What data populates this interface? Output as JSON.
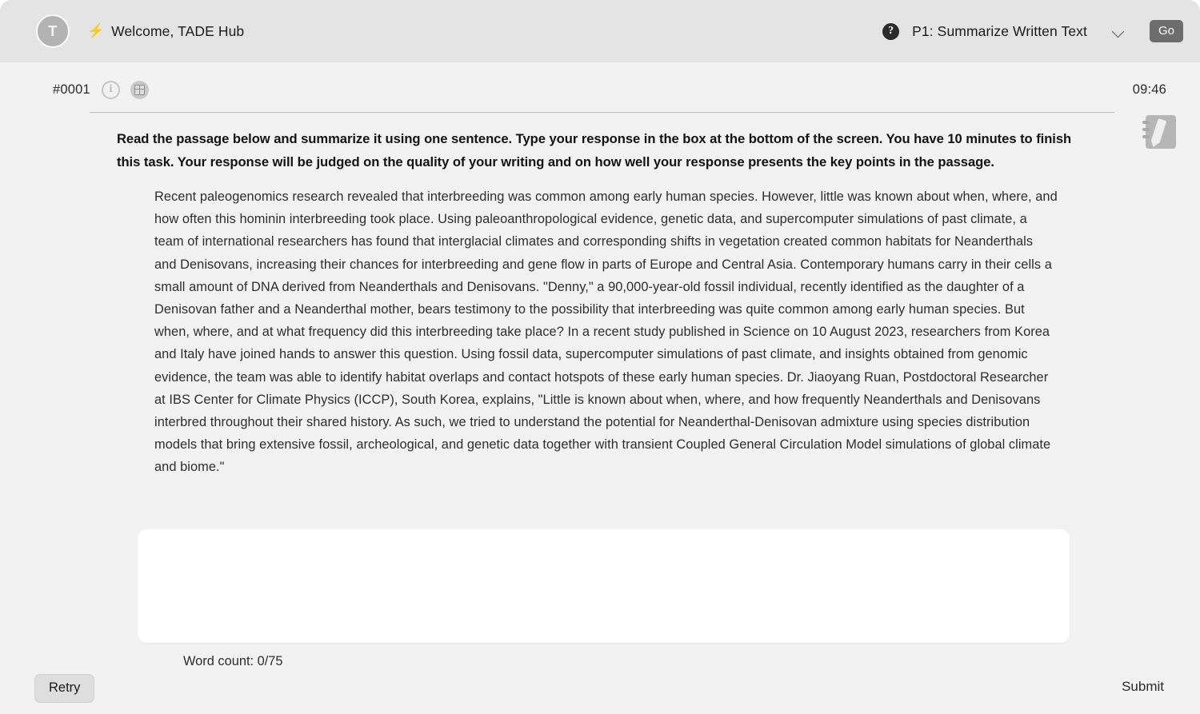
{
  "header": {
    "avatar_initial": "T",
    "bolt_icon": "⚡",
    "welcome_text": "Welcome, TADE Hub",
    "help_icon": "?",
    "task_label": "P1: Summarize Written Text",
    "go_label": "Go"
  },
  "item_bar": {
    "item_id": "#0001",
    "info_icon": "i",
    "timer": "09:46"
  },
  "task": {
    "instructions": "Read the passage below and summarize it using one sentence. Type your response in the box at the bottom of the screen. You have 10 minutes to finish this task. Your response will be judged on the quality of your writing and on how well your response presents the key points in the passage.",
    "passage": "Recent paleogenomics research revealed that interbreeding was common among early human species. However, little was known about when, where, and how often this hominin interbreeding took place. Using paleoanthropological evidence, genetic data, and supercomputer simulations of past climate, a team of international researchers has found that interglacial climates and corresponding shifts in vegetation created common habitats for Neanderthals and Denisovans, increasing their chances for interbreeding and gene flow in parts of Europe and Central Asia. Contemporary humans carry in their cells a small amount of DNA derived from Neanderthals and Denisovans. \"Denny,\" a 90,000-year-old fossil individual, recently identified as the daughter of a Denisovan father and a Neanderthal mother, bears testimony to the possibility that interbreeding was quite common among early human species. But when, where, and at what frequency did this interbreeding take place? In a recent study published in Science on 10 August 2023, researchers from Korea and Italy have joined hands to answer this question. Using fossil data, supercomputer simulations of past climate, and insights obtained from genomic evidence, the team was able to identify habitat overlaps and contact hotspots of these early human species. Dr. Jiaoyang Ruan, Postdoctoral Researcher at IBS Center for Climate Physics (ICCP), South Korea, explains, \"Little is known about when, where, and how frequently Neanderthals and Denisovans interbred throughout their shared history. As such, we tried to understand the potential for Neanderthal-Denisovan admixture using species distribution models that bring extensive fossil, archeological, and genetic data together with transient Coupled General Circulation Model simulations of global climate and biome.\""
  },
  "answer": {
    "value": "",
    "placeholder": "",
    "word_count": "Word count: 0/75"
  },
  "footer": {
    "retry_label": "Retry",
    "submit_label": "Submit"
  },
  "colors": {
    "page_background": "#f2f2f2",
    "header_background": "#e4e4e4",
    "go_button": "#6d6d6d",
    "retry_button": "#dedede",
    "answer_box": "#ffffff",
    "text_primary": "#2e2e2e"
  }
}
